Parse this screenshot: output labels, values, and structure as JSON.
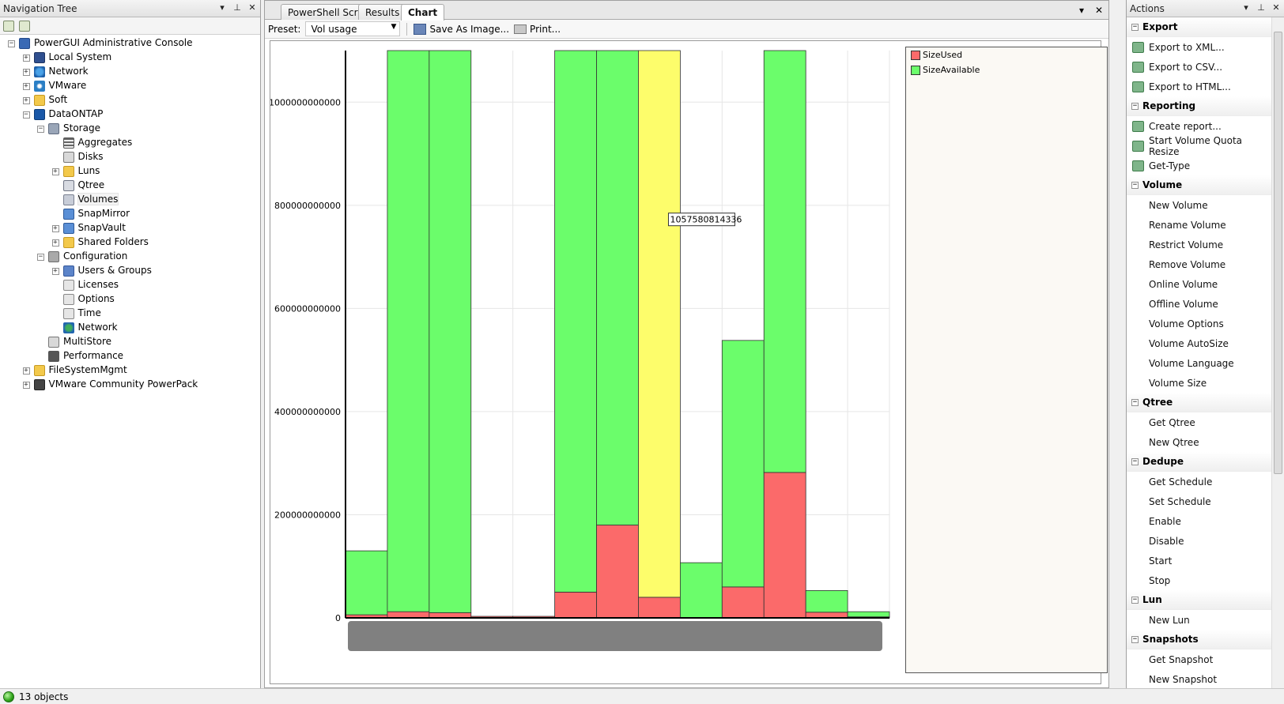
{
  "nav": {
    "title": "Navigation Tree",
    "tree": [
      {
        "label": "PowerGUI Administrative Console",
        "level": 0,
        "exp": "−",
        "icon": "console-icon"
      },
      {
        "label": "Local System",
        "level": 1,
        "exp": "+",
        "icon": "computer-icon"
      },
      {
        "label": "Network",
        "level": 1,
        "exp": "+",
        "icon": "network-icon"
      },
      {
        "label": "VMware",
        "level": 1,
        "exp": "+",
        "icon": "vmware-icon"
      },
      {
        "label": "Soft",
        "level": 1,
        "exp": "+",
        "icon": "folder-icon"
      },
      {
        "label": "DataONTAP",
        "level": 1,
        "exp": "−",
        "icon": "dataontap-icon"
      },
      {
        "label": "Storage",
        "level": 2,
        "exp": "−",
        "icon": "storage-icon"
      },
      {
        "label": "Aggregates",
        "level": 3,
        "exp": "",
        "icon": "aggregates-icon"
      },
      {
        "label": "Disks",
        "level": 3,
        "exp": "",
        "icon": "disk-icon"
      },
      {
        "label": "Luns",
        "level": 3,
        "exp": "+",
        "icon": "luns-icon"
      },
      {
        "label": "Qtree",
        "level": 3,
        "exp": "",
        "icon": "qtree-icon"
      },
      {
        "label": "Volumes",
        "level": 3,
        "exp": "",
        "icon": "volume-icon",
        "selected": true
      },
      {
        "label": "SnapMirror",
        "level": 3,
        "exp": "",
        "icon": "snapmirror-icon"
      },
      {
        "label": "SnapVault",
        "level": 3,
        "exp": "+",
        "icon": "snapvault-icon"
      },
      {
        "label": "Shared Folders",
        "level": 3,
        "exp": "+",
        "icon": "shared-folder-icon"
      },
      {
        "label": "Configuration",
        "level": 2,
        "exp": "−",
        "icon": "configuration-icon"
      },
      {
        "label": "Users & Groups",
        "level": 3,
        "exp": "+",
        "icon": "users-icon"
      },
      {
        "label": "Licenses",
        "level": 3,
        "exp": "",
        "icon": "licenses-icon"
      },
      {
        "label": "Options",
        "level": 3,
        "exp": "",
        "icon": "options-icon"
      },
      {
        "label": "Time",
        "level": 3,
        "exp": "",
        "icon": "time-icon"
      },
      {
        "label": "Network",
        "level": 3,
        "exp": "",
        "icon": "globe-icon"
      },
      {
        "label": "MultiStore",
        "level": 2,
        "exp": "",
        "icon": "multistore-icon"
      },
      {
        "label": "Performance",
        "level": 2,
        "exp": "",
        "icon": "performance-icon"
      },
      {
        "label": "FileSystemMgmt",
        "level": 1,
        "exp": "+",
        "icon": "folder-icon"
      },
      {
        "label": "VMware Community PowerPack",
        "level": 1,
        "exp": "+",
        "icon": "vmware-pack-icon"
      }
    ]
  },
  "center": {
    "tabs": [
      "PowerShell Script",
      "Results",
      "Chart"
    ],
    "active_tab": "Chart",
    "preset_label": "Preset:",
    "preset_value": "Vol usage",
    "save_label": "Save As Image...",
    "print_label": "Print...",
    "tooltip": "1057580814336"
  },
  "chart_data": {
    "type": "bar",
    "stacked": true,
    "categories": [
      "",
      "",
      "",
      "",
      "",
      "",
      "",
      "",
      "",
      "",
      "",
      "",
      "",
      ""
    ],
    "series": [
      {
        "name": "SizeUsed",
        "color": "#fb6a6a",
        "values": [
          6000000000,
          12000000000,
          10000000000,
          3000000000,
          3000000000,
          50000000000,
          180000000000,
          40000000000,
          0,
          60000000000,
          282000000000,
          11000000000,
          2000000000,
          0
        ]
      },
      {
        "name": "SizeAvailable",
        "color": "#6bfd6b",
        "values": [
          124000000000,
          1088000000000,
          1090000000000,
          0,
          0,
          1050000000000,
          920000000000,
          0,
          107000000000,
          478000000000,
          818000000000,
          42000000000,
          10000000000,
          0
        ]
      }
    ],
    "highlight": {
      "index": 7,
      "color": "#fdfd6b",
      "value": 1057580814336
    },
    "yticks": [
      0,
      200000000000,
      400000000000,
      600000000000,
      800000000000,
      1000000000000
    ],
    "ytick_labels": [
      "0",
      "200000000000",
      "400000000000",
      "600000000000",
      "800000000000",
      "1000000000000"
    ],
    "ylim": [
      0,
      1100000000000
    ],
    "grid": true,
    "legend_position": "right"
  },
  "actions": {
    "title": "Actions",
    "sections": [
      {
        "name": "Export",
        "items": [
          "Export to XML...",
          "Export to CSV...",
          "Export to HTML..."
        ],
        "icons": true
      },
      {
        "name": "Reporting",
        "items": [
          "Create report...",
          "Start Volume Quota Resize",
          "Get-Type"
        ],
        "icons": true
      },
      {
        "name": "Volume",
        "items": [
          "New Volume",
          "Rename Volume",
          "Restrict Volume",
          "Remove Volume",
          "Online Volume",
          "Offline Volume",
          "Volume Options",
          "Volume AutoSize",
          "Volume Language",
          "Volume Size"
        ]
      },
      {
        "name": "Qtree",
        "items": [
          "Get Qtree",
          "New Qtree"
        ]
      },
      {
        "name": "Dedupe",
        "items": [
          "Get Schedule",
          "Set Schedule",
          "Enable",
          "Disable",
          "Start",
          "Stop"
        ]
      },
      {
        "name": "Lun",
        "items": [
          "New Lun"
        ]
      },
      {
        "name": "Snapshots",
        "items": [
          "Get Snapshot",
          "New Snapshot"
        ]
      }
    ]
  },
  "status": {
    "text": "13 objects"
  }
}
